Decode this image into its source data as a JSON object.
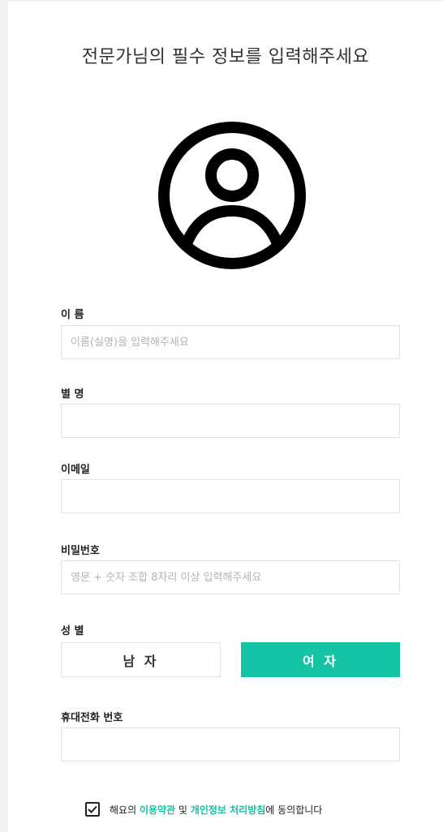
{
  "header": {
    "title": "전문가님의 필수 정보를 입력해주세요"
  },
  "profile": {
    "avatar_icon": "user-circle-icon"
  },
  "form": {
    "name": {
      "label": "이 름",
      "value": "",
      "placeholder": "이름(실명)을 입력해주세요"
    },
    "nickname": {
      "label": "별 명",
      "value": "",
      "placeholder": ""
    },
    "email": {
      "label": "이메일",
      "value": "",
      "placeholder": ""
    },
    "password": {
      "label": "비밀번호",
      "value": "",
      "placeholder": "영문 + 숫자 조합 8자리 이상 입력해주세요"
    },
    "gender": {
      "label": "성 별",
      "options": [
        "남 자",
        "여 자"
      ],
      "selected": "여 자"
    },
    "phone": {
      "label": "휴대전화 번호",
      "value": "",
      "placeholder": ""
    }
  },
  "agreement": {
    "checked": true,
    "prefix": "해요의 ",
    "terms_link": "이용약관",
    "connector": " 및 ",
    "privacy_link": "개인정보 처리방침",
    "suffix": "에 동의합니다"
  },
  "colors": {
    "accent": "#14c3a3",
    "border": "#e3e3e3",
    "text": "#222222",
    "placeholder": "#b3b3b3"
  }
}
